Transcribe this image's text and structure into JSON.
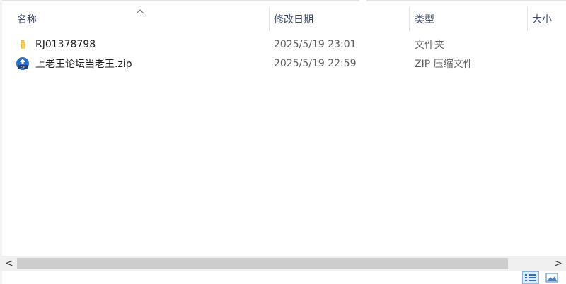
{
  "columns": {
    "name": "名称",
    "date_modified": "修改日期",
    "type": "类型",
    "size": "大小"
  },
  "sort": {
    "column": "name",
    "icon": "sort-up-chevron-icon"
  },
  "files": [
    {
      "name": "RJ01378798",
      "date_modified": "2025/5/19 23:01",
      "type": "文件夹",
      "icon": "folder-icon"
    },
    {
      "name": "上老王论坛当老王.zip",
      "date_modified": "2025/5/19 22:59",
      "type": "ZIP 压缩文件",
      "icon": "zip-archive-icon"
    }
  ],
  "scrollbar": {
    "left_arrow": "<",
    "right_arrow": ">"
  },
  "view_modes": [
    "details-view-icon",
    "large-icons-view-icon"
  ],
  "colors": {
    "header_text": "#3c4b6b",
    "folder": "#f3c44a",
    "zip_badge": "#2f6fc9",
    "active_view": "#dcebfb"
  }
}
